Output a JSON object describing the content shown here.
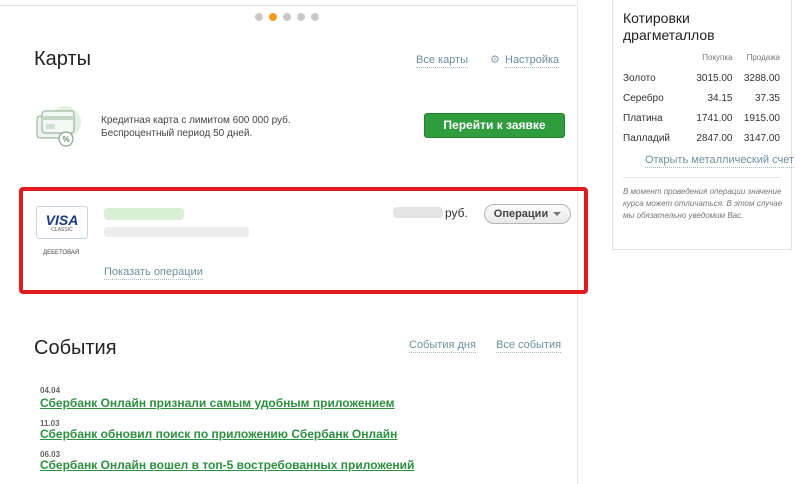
{
  "carousel": {
    "count": 5,
    "active_index": 2
  },
  "cards_section": {
    "title": "Карты",
    "all_cards_link": "Все карты",
    "settings_link": "Настройка"
  },
  "promo": {
    "line1": "Кредитная карта с лимитом 600 000 руб.",
    "line2": "Беспроцентный период 50 дней.",
    "apply_button": "Перейти к заявке",
    "icon": "credit-cards-icon"
  },
  "card": {
    "brand": "VISA",
    "brand_sub": "CLASSIC",
    "type": "ДЕБЕТОВАЯ",
    "currency": "руб.",
    "operations_button": "Операции",
    "show_operations_link": "Показать операции"
  },
  "events_section": {
    "title": "События",
    "day_events_link": "События дня",
    "all_events_link": "Все события",
    "items": [
      {
        "date": "04.04",
        "title": "Сбербанк Онлайн признали самым удобным приложением"
      },
      {
        "date": "11.03",
        "title": "Сбербанк обновил поиск по приложению Сбербанк Онлайн"
      },
      {
        "date": "06.03",
        "title": "Сбербанк Онлайн вошел в топ-5 востребованных приложений"
      }
    ]
  },
  "metals": {
    "title": "Котировки драгметаллов",
    "col_buy": "Покупка",
    "col_sell": "Продажа",
    "rows": [
      {
        "name": "Золото",
        "buy": "3015.00",
        "sell": "3288.00"
      },
      {
        "name": "Серебро",
        "buy": "34.15",
        "sell": "37.35"
      },
      {
        "name": "Платина",
        "buy": "1741.00",
        "sell": "1915.00"
      },
      {
        "name": "Палладий",
        "buy": "2847.00",
        "sell": "3147.00"
      }
    ],
    "open_account_link": "Открыть металлический счет",
    "note": "В момент проведения операции значение курса может отличаться. В этом случае мы обязательно уведомим Вас."
  },
  "colors": {
    "accent_green": "#2f9c3e",
    "highlight_red": "#e11b22",
    "carousel_active": "#f39c19",
    "link_gray": "#6d8f9e"
  }
}
